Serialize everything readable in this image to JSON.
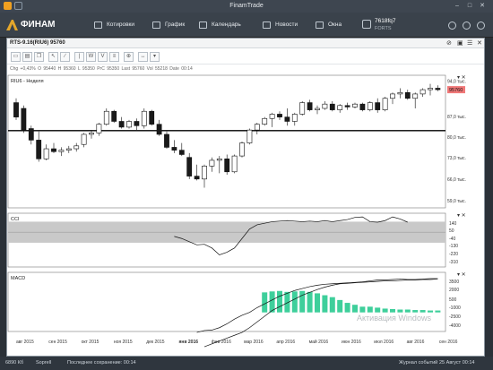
{
  "window": {
    "title": "FinamTrade"
  },
  "app": {
    "brand": "ФИНАМ"
  },
  "nav": [
    {
      "label": "Котировки"
    },
    {
      "label": "График"
    },
    {
      "label": "Календарь"
    },
    {
      "label": "Новости"
    },
    {
      "label": "Окна"
    }
  ],
  "account": {
    "id": "7618fq7",
    "market": "FORTS"
  },
  "chart_window": {
    "title": "RTS-9.16(RIU6) 95760"
  },
  "quote_line": {
    "chg": "Chg +0,43%",
    "open": "O 95440",
    "high": "H 95360",
    "low": "L 95350",
    "prev": "PrC 95350",
    "last": "Last 95760",
    "vol": "Vol 55218",
    "date": "Date 00:14"
  },
  "main_legend": "RIU6 - Неделя",
  "cci_legend": "CCI",
  "macd_legend": "MACD",
  "price_badge": "95760",
  "watermark": "Активация Windows",
  "colors": {
    "up": "#ffffff",
    "down": "#1a1a1a",
    "macd_hist": "#3ecf9b",
    "badge": "#f07878",
    "level_line": "#000000"
  },
  "status": {
    "memory": "6890 Кб",
    "connection": "Soprell",
    "saved": "Последнее сохранение: 00:14",
    "journal": "Журнал событий",
    "date": "25 Август 00:14"
  },
  "chart_data": [
    {
      "type": "candlestick",
      "title": "RIU6 - Неделя",
      "ylim": [
        54000,
        100000
      ],
      "y_ticks": [
        "94,0 тыс.",
        "87,0 тыс.",
        "80,0 тыс.",
        "73,0 тыс.",
        "66,0 тыс.",
        "59,0 тыс."
      ],
      "x_ticks": [
        "авг 2015",
        "сен 2015",
        "окт 2015",
        "ноя 2015",
        "дек 2015",
        "янв 2016",
        "фев 2016",
        "мар 2016",
        "апр 2016",
        "май 2016",
        "июн 2016",
        "июл 2016",
        "авг 2016",
        "сен 2016"
      ],
      "level_line": 80800,
      "candles": [
        [
          90500,
          92000,
          84500,
          85500
        ],
        [
          88500,
          89500,
          80000,
          81000
        ],
        [
          81500,
          82500,
          76000,
          77500
        ],
        [
          77500,
          80500,
          70000,
          71000
        ],
        [
          71000,
          76000,
          70500,
          74500
        ],
        [
          74500,
          76500,
          73000,
          73500
        ],
        [
          73500,
          75000,
          72000,
          74000
        ],
        [
          74000,
          75500,
          73000,
          74500
        ],
        [
          74500,
          76500,
          73500,
          75500
        ],
        [
          76000,
          80000,
          75000,
          79500
        ],
        [
          79500,
          81000,
          78000,
          80000
        ],
        [
          80000,
          83500,
          79000,
          83000
        ],
        [
          83000,
          88500,
          82500,
          87500
        ],
        [
          87500,
          88000,
          83500,
          84000
        ],
        [
          84000,
          85500,
          81500,
          82000
        ],
        [
          82000,
          84500,
          81500,
          84000
        ],
        [
          84000,
          85000,
          81000,
          82500
        ],
        [
          82500,
          88500,
          81500,
          87500
        ],
        [
          87500,
          88000,
          82500,
          83000
        ],
        [
          83000,
          84500,
          79000,
          79500
        ],
        [
          79500,
          80500,
          74500,
          75000
        ],
        [
          75000,
          77500,
          73000,
          74000
        ],
        [
          74000,
          76500,
          72000,
          72500
        ],
        [
          71500,
          73000,
          64000,
          65000
        ],
        [
          65000,
          69000,
          63500,
          64000
        ],
        [
          64000,
          69000,
          61000,
          68500
        ],
        [
          68500,
          71500,
          66500,
          70500
        ],
        [
          70500,
          72000,
          66000,
          71000
        ],
        [
          71000,
          72500,
          65500,
          66500
        ],
        [
          66500,
          72500,
          66000,
          72000
        ],
        [
          72000,
          77000,
          71500,
          76500
        ],
        [
          76500,
          81500,
          76000,
          81000
        ],
        [
          81000,
          83500,
          79500,
          83000
        ],
        [
          83000,
          85500,
          82500,
          85000
        ],
        [
          85000,
          87000,
          82000,
          86500
        ],
        [
          86500,
          87500,
          84500,
          85500
        ],
        [
          85500,
          88500,
          82500,
          84000
        ],
        [
          84000,
          87000,
          82500,
          86500
        ],
        [
          86500,
          91000,
          86000,
          90500
        ],
        [
          90500,
          91500,
          87500,
          88000
        ],
        [
          88000,
          89500,
          86500,
          88500
        ],
        [
          88500,
          91000,
          88000,
          90000
        ],
        [
          90000,
          91000,
          87500,
          88000
        ],
        [
          88000,
          90000,
          87000,
          89500
        ],
        [
          89500,
          90500,
          88000,
          89000
        ],
        [
          89000,
          90500,
          88500,
          90000
        ],
        [
          90000,
          90500,
          87500,
          88000
        ],
        [
          88000,
          91000,
          87500,
          90500
        ],
        [
          90500,
          92000,
          87000,
          88000
        ],
        [
          88000,
          92500,
          87500,
          92000
        ],
        [
          92000,
          94000,
          90000,
          93500
        ],
        [
          93500,
          95500,
          92000,
          94000
        ],
        [
          94000,
          95000,
          91500,
          92000
        ],
        [
          92000,
          94000,
          88500,
          93500
        ],
        [
          93500,
          95500,
          92500,
          95000
        ],
        [
          95000,
          97000,
          93000,
          95500
        ],
        [
          95500,
          96500,
          94500,
          95000
        ]
      ]
    },
    {
      "type": "line",
      "title": "CCI",
      "ylim": [
        -330,
        180
      ],
      "y_ticks": [
        "140",
        "50",
        "-40",
        "-130",
        "-220",
        "-310"
      ],
      "band": [
        -100,
        100
      ],
      "values": [
        null,
        null,
        null,
        null,
        null,
        null,
        null,
        null,
        null,
        null,
        null,
        null,
        null,
        null,
        null,
        null,
        null,
        null,
        null,
        null,
        null,
        -40,
        -60,
        -90,
        -120,
        -115,
        -150,
        -215,
        -190,
        -150,
        -60,
        30,
        70,
        85,
        100,
        105,
        110,
        105,
        100,
        105,
        100,
        110,
        100,
        110,
        120,
        140,
        145,
        100,
        95,
        110,
        145,
        125,
        95
      ]
    },
    {
      "type": "bar",
      "title": "MACD",
      "ylim": [
        -2000,
        4200
      ],
      "y_ticks": [
        "3500",
        "2000",
        "500",
        "-1000",
        "-2500",
        "-4000"
      ],
      "x_index_start": 24,
      "histogram": [
        null,
        null,
        null,
        null,
        null,
        null,
        null,
        null,
        null,
        2100,
        2200,
        2250,
        2150,
        2200,
        2250,
        2150,
        2000,
        1800,
        1600,
        1300,
        1000,
        800,
        600,
        600,
        500,
        400,
        350,
        300,
        300,
        250,
        250,
        200,
        200
      ],
      "macd": [
        -2100,
        -1900,
        -1850,
        -1600,
        -1200,
        -700,
        -300,
        0,
        500,
        900,
        1300,
        1700,
        2000,
        2300,
        2500,
        2700,
        2850,
        2950,
        3000,
        3050,
        3100,
        3150,
        3200,
        3300,
        3400,
        3400,
        3450,
        3500,
        3450,
        3450,
        3500,
        3550,
        3550
      ],
      "signal": [
        null,
        -3600,
        -3300,
        -3000,
        -2700,
        -2400,
        -2100,
        -1600,
        -1000,
        -400,
        200,
        600,
        1000,
        1400,
        1800,
        2100,
        2400,
        2650,
        2850,
        3000,
        3050,
        3100,
        3150,
        3200,
        3250,
        3300,
        3300,
        3350,
        3400,
        3400,
        3450,
        3450,
        3500
      ]
    }
  ]
}
